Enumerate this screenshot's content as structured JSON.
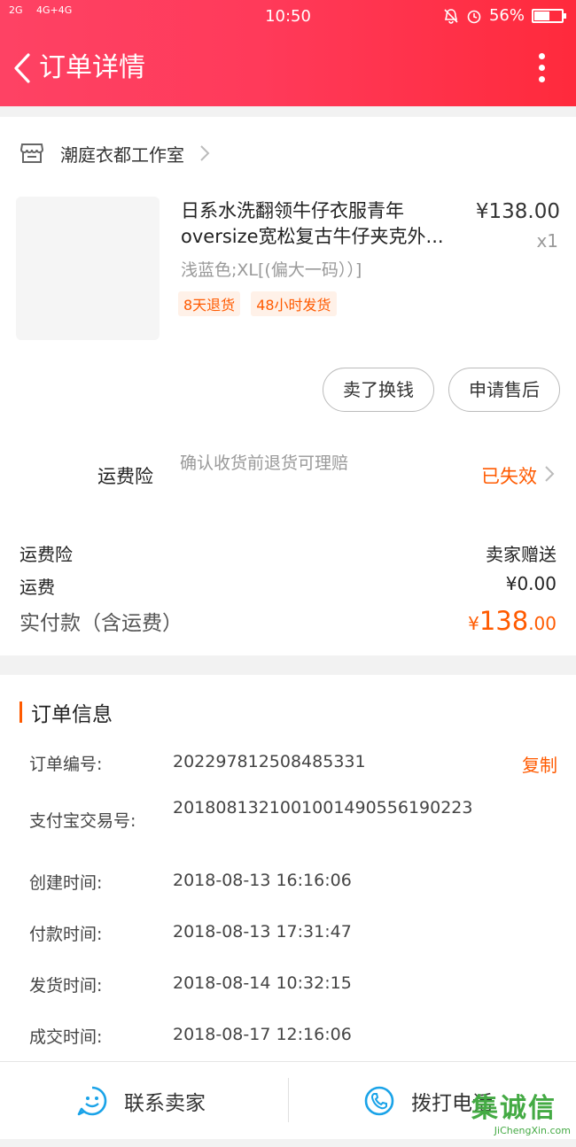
{
  "status_bar": {
    "signal_left": "2G",
    "signal_right": "4G+4G",
    "time": "10:50",
    "battery": "56%",
    "battery_level": 0.56
  },
  "navbar": {
    "title": "订单详情",
    "back_icon": "chevron-left-icon",
    "more_icon": "more-vertical-icon"
  },
  "store": {
    "shop_name": "潮庭衣都工作室",
    "product": {
      "title": "日系水洗翻领牛仔衣服青年oversize宽松复古牛仔夹克外...",
      "price": "¥138.00",
      "quantity": "x1",
      "sku": "浅蓝色;XL[(偏大一码））]",
      "tags": [
        "8天退货",
        "48小时发货"
      ]
    },
    "buttons": [
      "卖了换钱",
      "申请售后"
    ],
    "insurance": {
      "label": "运费险",
      "description": "确认收货前退货可理赔",
      "status": "已失效"
    },
    "fees": [
      {
        "label": "运费险",
        "value": "卖家赠送"
      },
      {
        "label": "运费",
        "value": "¥0.00"
      }
    ],
    "total": {
      "label": "实付款（含运费）",
      "currency": "¥",
      "integer": "138",
      "decimal": ".00"
    }
  },
  "order_info": {
    "title": "订单信息",
    "copy_label": "复制",
    "rows": [
      {
        "label": "订单编号:",
        "value": "202297812508485331"
      },
      {
        "label": "支付宝交易号:",
        "value": "2018081321001001490556190223"
      },
      {
        "label": "创建时间:",
        "value": "2018-08-13 16:16:06"
      },
      {
        "label": "付款时间:",
        "value": "2018-08-13 17:31:47"
      },
      {
        "label": "发货时间:",
        "value": "2018-08-14 10:32:15"
      },
      {
        "label": "成交时间:",
        "value": "2018-08-17 12:16:06"
      }
    ]
  },
  "bottom_bar": {
    "contact_seller": "联系卖家",
    "call_phone": "拨打电话"
  },
  "watermark": {
    "big": "集诚信",
    "small": "JiChengXin.com"
  },
  "colors": {
    "header_start": "#fe4264",
    "header_end": "#ff2a3c",
    "accent_orange": "#ff5a00",
    "icon_blue": "#1aa3e8"
  }
}
